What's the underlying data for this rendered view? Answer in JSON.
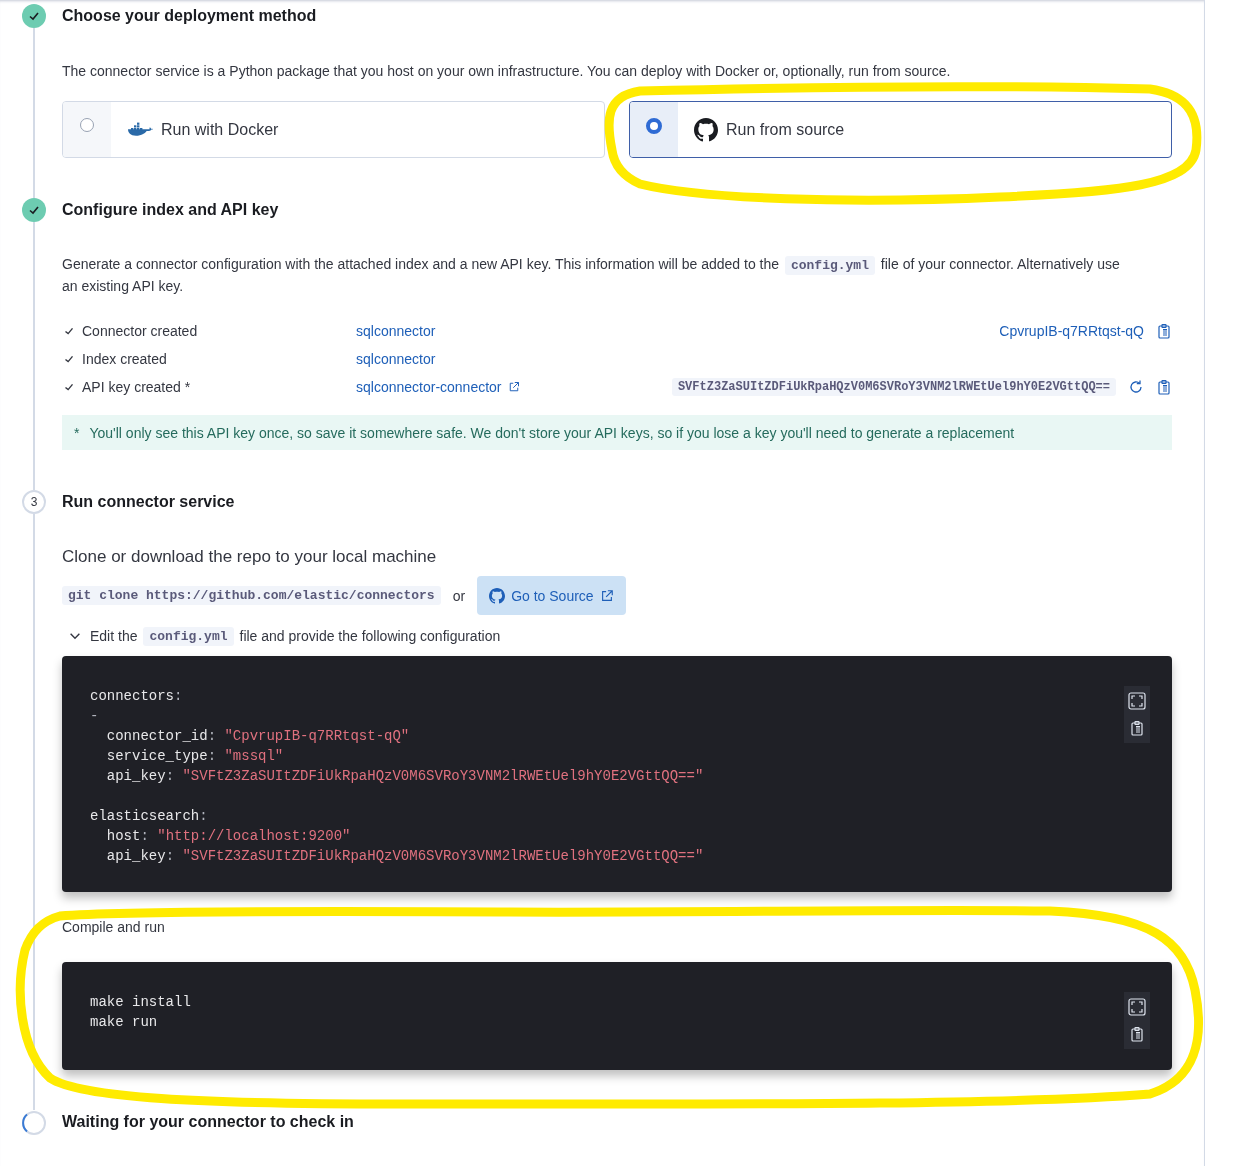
{
  "steps": [
    {
      "kind": "complete",
      "title": "Choose your deployment method",
      "description": "The connector service is a Python package that you host on your own infrastructure. You can deploy with Docker or, optionally, run from source.",
      "options": [
        {
          "label": "Run with Docker",
          "selected": false
        },
        {
          "label": "Run from source",
          "selected": true
        }
      ]
    },
    {
      "kind": "complete",
      "title": "Configure index and API key",
      "description": [
        {
          "text": "Generate a connector configuration with the attached index and a new API key. This information will be added to the "
        },
        {
          "code": "config.yml"
        },
        {
          "text": " file of your connector. Alternatively use an existing API key."
        }
      ],
      "status_rows": [
        {
          "label": "Connector created",
          "link": "sqlconnector",
          "id": "CpvrupIB-q7RRtqst-qQ"
        },
        {
          "label": "Index created",
          "link": "sqlconnector"
        },
        {
          "label": "API key created *",
          "link": "sqlconnector-connector",
          "external": true,
          "api_key": "SVFtZ3ZaSUItZDFiUkRpaHQzV0M6SVRoY3VNM2lRWEtUel9hY0E2VGttQQ=="
        }
      ],
      "callout": {
        "marker": "*",
        "text": "You'll only see this API key once, so save it somewhere safe. We don't store your API keys, so if you lose a key you'll need to generate a replacement"
      }
    },
    {
      "kind": "numbered",
      "number": "3",
      "title": "Run connector service",
      "clone_text": "Clone or download the repo to your local machine",
      "clone_command": "git clone https://github.com/elastic/connectors",
      "or_text": "or",
      "source_button": "Go to Source",
      "edit_line": {
        "expanded": true,
        "parts": [
          {
            "text": "Edit the"
          },
          {
            "code": "config.yml"
          },
          {
            "text": "file and provide the following configuration"
          }
        ]
      },
      "config_block": [
        [
          [
            {
              "kind": "key",
              "text": "connectors"
            },
            {
              "kind": "punct",
              "text": ":"
            }
          ],
          [
            {
              "kind": "punct",
              "text": "-"
            }
          ],
          [
            {
              "kind": "key",
              "text": "  connector_id"
            },
            {
              "kind": "punct",
              "text": ": "
            },
            {
              "kind": "string",
              "text": "\"CpvrupIB-q7RRtqst-qQ\""
            }
          ],
          [
            {
              "kind": "key",
              "text": "  service_type"
            },
            {
              "kind": "punct",
              "text": ": "
            },
            {
              "kind": "string",
              "text": "\"mssql\""
            }
          ],
          [
            {
              "kind": "key",
              "text": "  api_key"
            },
            {
              "kind": "punct",
              "text": ": "
            },
            {
              "kind": "string",
              "text": "\"SVFtZ3ZaSUItZDFiUkRpaHQzV0M6SVRoY3VNM2lRWEtUel9hY0E2VGttQQ==\""
            }
          ]
        ],
        [
          [
            {
              "kind": "key",
              "text": "elasticsearch"
            },
            {
              "kind": "punct",
              "text": ":"
            }
          ],
          [
            {
              "kind": "key",
              "text": "  host"
            },
            {
              "kind": "punct",
              "text": ": "
            },
            {
              "kind": "string",
              "text": "\"http://localhost:9200\""
            }
          ],
          [
            {
              "kind": "key",
              "text": "  api_key"
            },
            {
              "kind": "punct",
              "text": ": "
            },
            {
              "kind": "string",
              "text": "\"SVFtZ3ZaSUItZDFiUkRpaHQzV0M6SVRoY3VNM2lRWEtUel9hY0E2VGttQQ==\""
            }
          ]
        ]
      ],
      "compile_text": "Compile and run",
      "compile_block": [
        [
          "make install",
          "make run"
        ]
      ]
    },
    {
      "kind": "loading",
      "title": "Waiting for your connector to check in"
    }
  ]
}
